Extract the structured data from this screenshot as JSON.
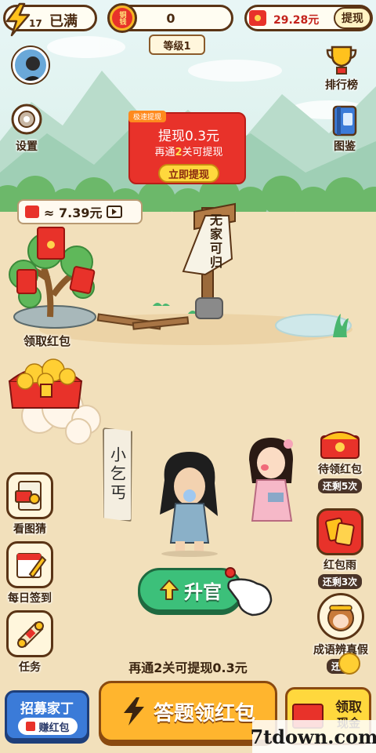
{
  "top_bar": {
    "energy_level": "17",
    "energy_status": "已满",
    "coin_icon_text": "铜钱",
    "coins": "0",
    "level": "等级1",
    "cash_balance": "29.28元",
    "withdraw_label": "提现"
  },
  "right_menu": {
    "leaderboard": "排行榜",
    "gallery": "图鉴"
  },
  "left_menu": {
    "settings": "设置"
  },
  "withdraw_banner": {
    "tag": "极速提现",
    "title": "提现0.3元",
    "subtitle_prefix": "再通",
    "subtitle_num": "2",
    "subtitle_suffix": "关可提现",
    "button": "立即提现"
  },
  "tree": {
    "estimate": "≈ 7.39元",
    "label": "领取红包"
  },
  "signpost": "无家可归",
  "character": {
    "title": "小乞丐"
  },
  "left_features": [
    {
      "label": "看图猜",
      "icon": "picture-guess-icon"
    },
    {
      "label": "每日签到",
      "icon": "calendar-pen-icon"
    },
    {
      "label": "任务",
      "icon": "scroll-icon"
    }
  ],
  "right_features": [
    {
      "label": "待领红包",
      "sub": "还剩5次"
    },
    {
      "label": "红包雨",
      "sub": "还剩3次"
    },
    {
      "label": "成语辨真假",
      "sub": "还剩"
    }
  ],
  "promote_button": "升官",
  "progress_hint": "再通2关可提现0.3元",
  "bottom": {
    "recruit_title": "招募家丁",
    "recruit_sub": "赚红包",
    "answer_button": "答题领红包",
    "claim_title": "领取",
    "claim_sub": "现金"
  },
  "watermark": "7tdown.com",
  "colors": {
    "sky": "#dff2f5",
    "ground": "#f2e0bb",
    "accent_red": "#e8322a",
    "brand_green": "#3cc07a",
    "button_orange": "#ffb52e",
    "outline_brown": "#5a3415"
  }
}
